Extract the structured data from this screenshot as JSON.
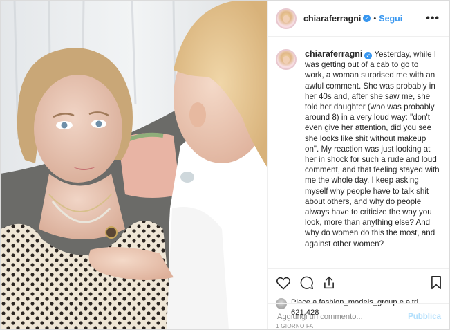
{
  "post": {
    "username": "chiaraferragni",
    "follow_label": "Segui",
    "more_label": "•••",
    "caption": "Yesterday, while I was getting out of a cab to go to work, a woman surprised me with an awful comment. She was probably in her 40s and, after she saw me, she told her daughter (who was probably around 8) in a very loud way: \"don't even give her attention, did you see she looks like shit without makeup on\". My reaction was just looking at her in shock for such a rude and loud comment, and that feeling stayed with me the whole day. I keep asking myself why people have to talk shit about others, and why do people always have to criticize the way you look, more than anything else? And why do women do this the most, and against other women?",
    "likes_text": "Piace a fashion_models_group e altri 621.428",
    "timestamp": "1 GIORNO FA",
    "comment_placeholder": "Aggiungi un commento...",
    "publish_label": "Pubblica"
  },
  "icons": {
    "like": "heart-icon",
    "comment": "comment-icon",
    "share": "share-icon",
    "save": "bookmark-icon",
    "verified": "verified-badge-icon"
  },
  "colors": {
    "link_blue": "#3897f0",
    "publish_disabled": "#b2dffc",
    "muted": "#8e8e8e",
    "text": "#262626",
    "border": "#dbdbdb"
  }
}
